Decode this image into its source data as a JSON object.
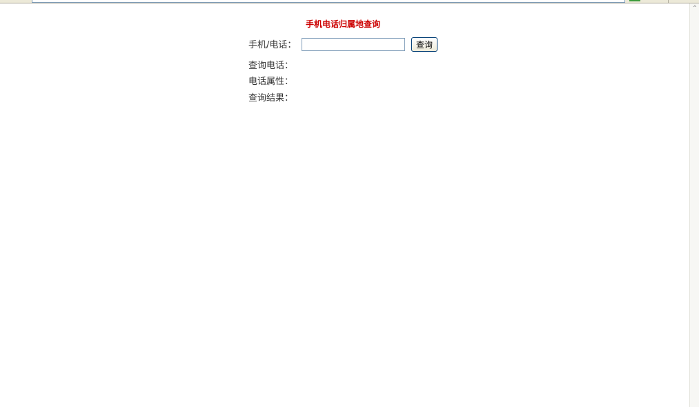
{
  "page": {
    "title": "手机电话归属地查询",
    "phone_label": "手机/电话：",
    "phone_value": "",
    "query_button": "查询",
    "result_labels": {
      "query_phone": "查询电话：",
      "phone_attr": "电话属性：",
      "query_result": "查询结果："
    }
  },
  "colors": {
    "title": "#cc0000",
    "label": "#333333"
  }
}
